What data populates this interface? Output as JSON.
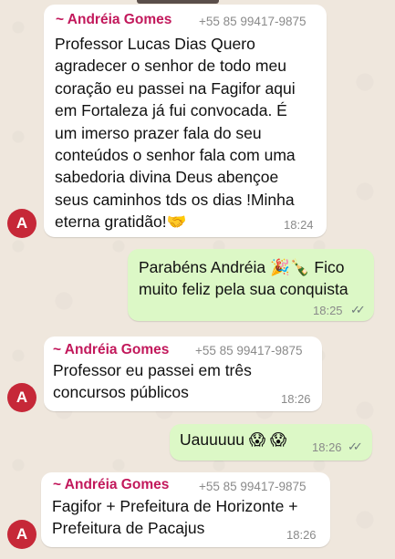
{
  "messages": [
    {
      "sender": "~ Andréia Gomes",
      "phone": "+55 85 99417-9875",
      "text": "Professor Lucas Dias Quero\nagradecer o senhor de todo meu\ncoração eu passei na Fagifor aqui\nem Fortaleza já fui convocada. É\num imerso prazer fala do seu\nconteúdos o senhor fala com uma\nsabedoria divina Deus abençoe\nseus caminhos tds os dias !Minha\neterna gratidão!🤝",
      "time": "18:24",
      "avatar": "A"
    },
    {
      "text": "Parabéns Andréia 🎉🍾 Fico\nmuito feliz pela sua conquista",
      "time": "18:25",
      "status": "read",
      "ticks": "✓✓"
    },
    {
      "sender": "~ Andréia Gomes",
      "phone": "+55 85 99417-9875",
      "text": "Professor eu passei em três\nconcursos públicos",
      "time": "18:26",
      "avatar": "A"
    },
    {
      "text": "Uauuuuu 😱 😱",
      "time": "18:26",
      "status": "read",
      "ticks": "✓✓"
    },
    {
      "sender": "~ Andréia Gomes",
      "phone": "+55 85 99417-9875",
      "text": "Fagifor + Prefeitura de Horizonte +\nPrefeitura de Pacajus",
      "time": "18:26",
      "avatar": "A"
    }
  ]
}
